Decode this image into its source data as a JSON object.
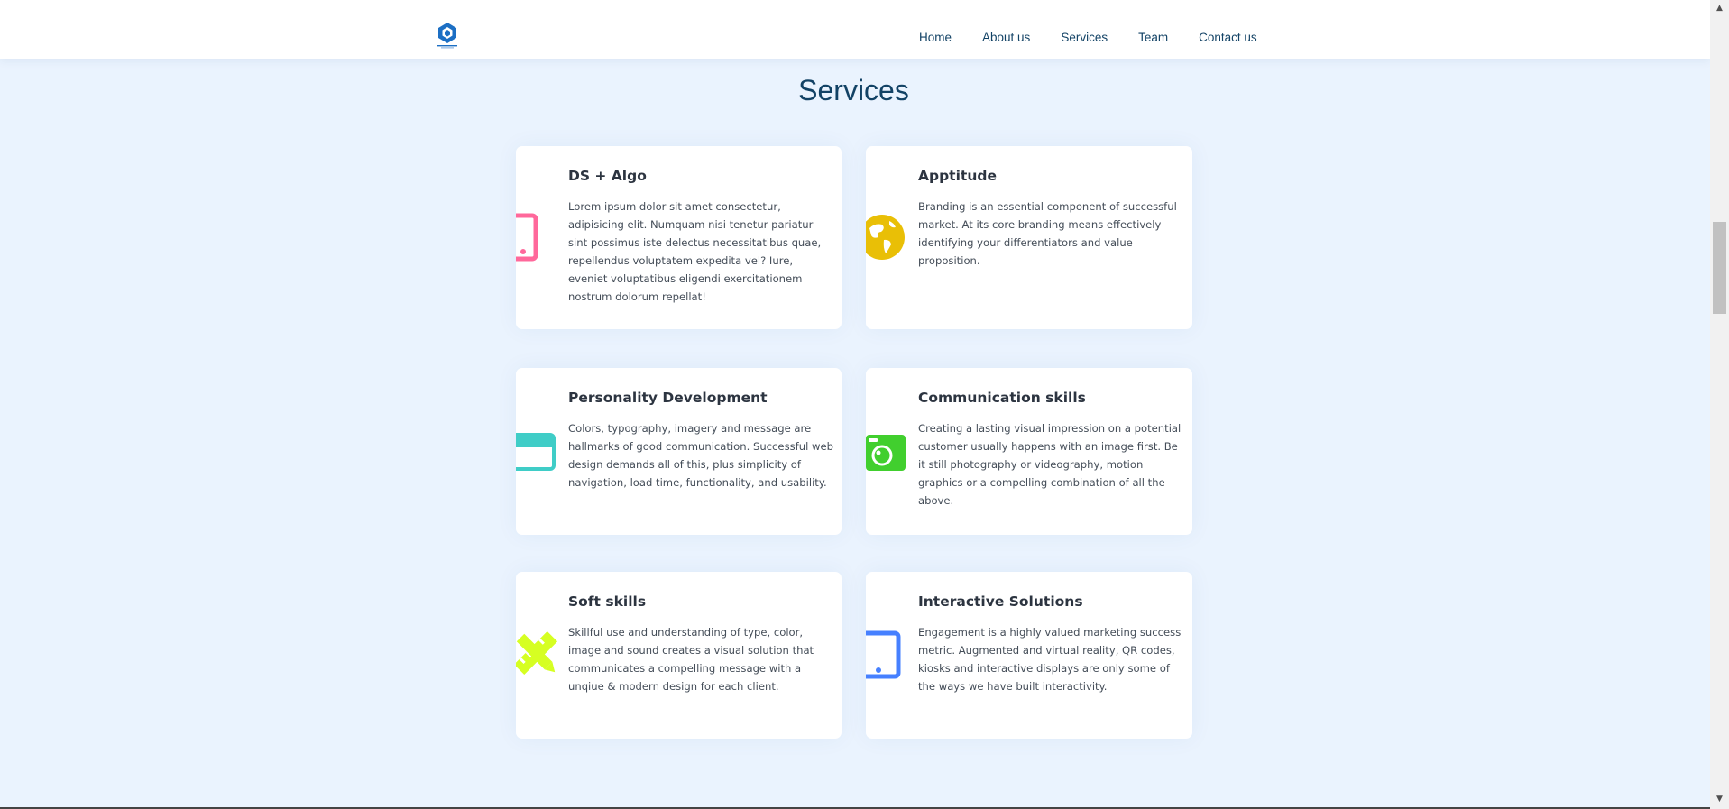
{
  "nav": {
    "logo_name": "cube-logo",
    "links": [
      "Home",
      "About us",
      "Services",
      "Team",
      "Contact us"
    ]
  },
  "services": {
    "title": "Services",
    "items": [
      {
        "title": "DS + Algo",
        "icon": "mobile-phone-icon",
        "color": "#ff689b",
        "text": "Lorem ipsum dolor sit amet consectetur, adipisicing elit. Numquam nisi tenetur pariatur sint possimus iste delectus necessitatibus quae, repellendus voluptatem expedita vel? Iure, eveniet voluptatibus eligendi exercitationem nostrum dolorum repellat!"
      },
      {
        "title": "Apptitude",
        "icon": "globe-icon",
        "color": "#e9bf06",
        "text": "Branding is an essential component of successful market. At its core branding means effectively identifying your differentiators and value proposition."
      },
      {
        "title": "Personality Development",
        "icon": "browser-window-icon",
        "color": "#3fcdc7",
        "text": "Colors, typography, imagery and message are hallmarks of good communication. Successful web design demands all of this, plus simplicity of navigation, load time, functionality, and usability."
      },
      {
        "title": "Communication skills",
        "icon": "camera-icon",
        "color": "#41cf2e",
        "text": "Creating a lasting visual impression on a potential customer usually happens with an image first. Be it still photography or videography, motion graphics or a compelling combination of all the above."
      },
      {
        "title": "Soft skills",
        "icon": "pencil-ruler-icon",
        "color": "#d6ff22",
        "text": "Skillful use and understanding of type, color, image and sound creates a visual solution that communicates a compelling message with a unqiue & modern design for each client."
      },
      {
        "title": "Interactive Solutions",
        "icon": "tablet-icon",
        "color": "#4680ff",
        "text": "Engagement is a highly valued marketing success metric. Augmented and virtual reality, QR codes, kiosks and interactive displays are only some of the ways we have built interactivity."
      }
    ]
  }
}
